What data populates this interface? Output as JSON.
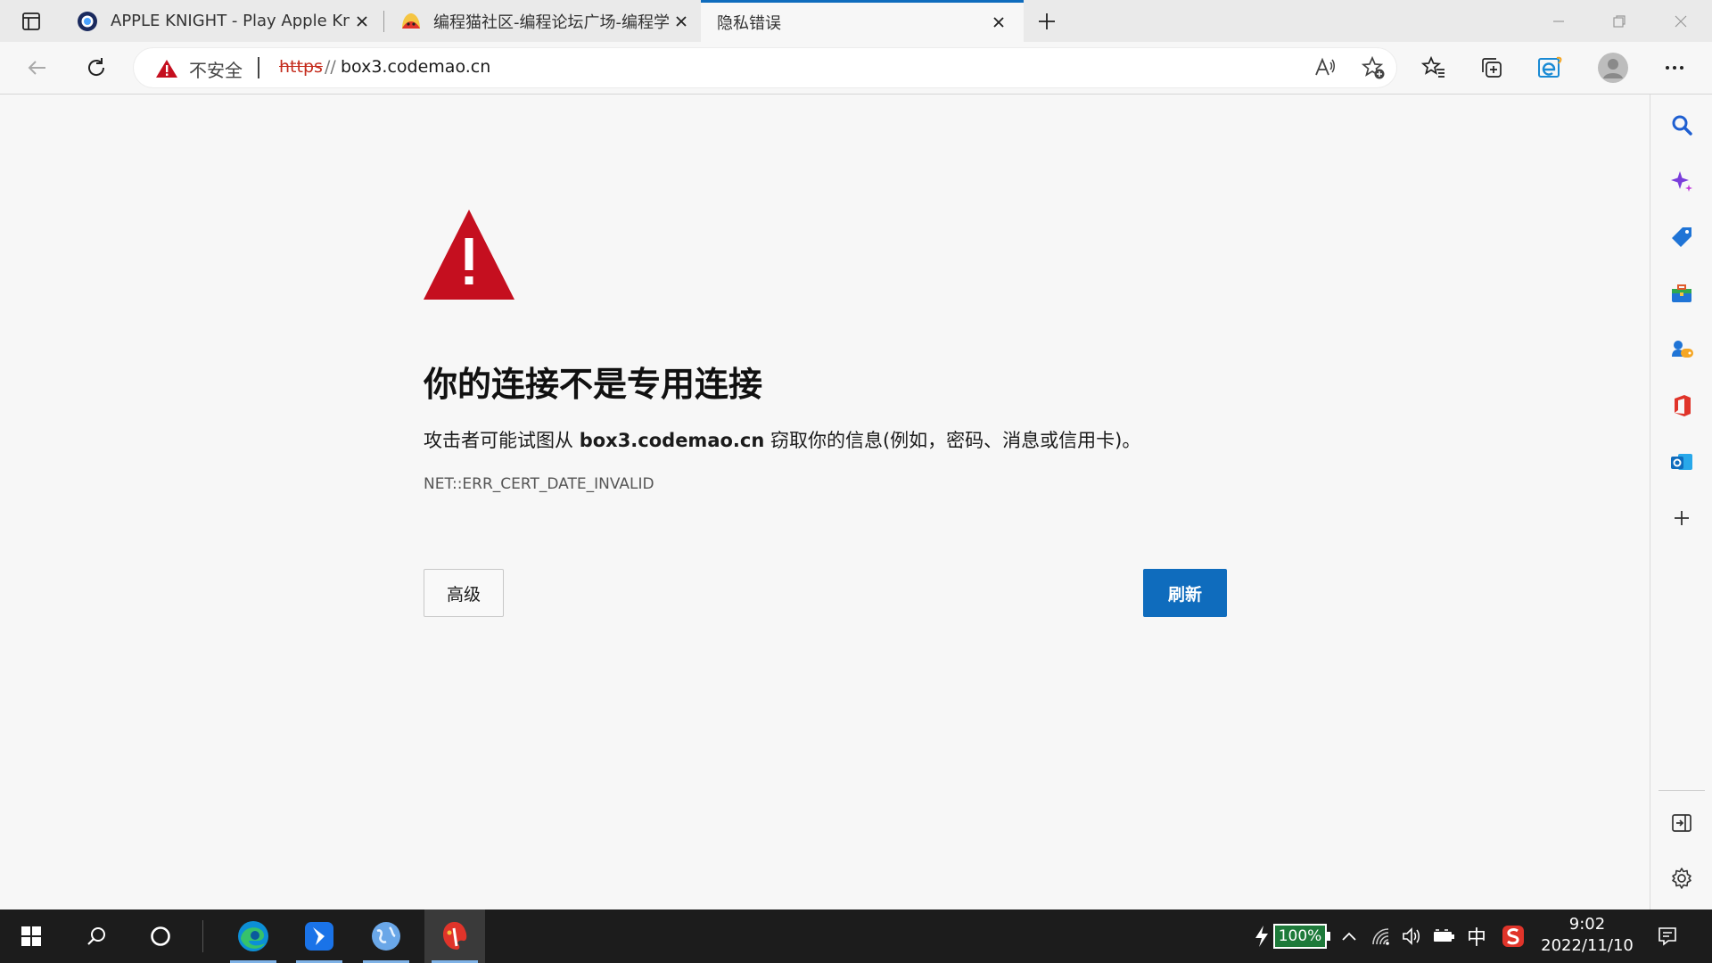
{
  "tabs": [
    {
      "title": "APPLE KNIGHT - Play Apple Knig",
      "active": false,
      "favicon": "globe-ring-icon"
    },
    {
      "title": "编程猫社区-编程论坛广场-编程学",
      "active": false,
      "favicon": "codemao-cat-icon"
    },
    {
      "title": "隐私错误",
      "active": true,
      "favicon": ""
    }
  ],
  "address": {
    "security_label": "不安全",
    "scheme": "https",
    "separator": "//",
    "host": "box3.codemao.cn"
  },
  "error": {
    "title": "你的连接不是专用连接",
    "desc_before": "攻击者可能试图从 ",
    "desc_host": "box3.codemao.cn",
    "desc_after": " 窃取你的信息(例如，密码、消息或信用卡)。",
    "code": "NET::ERR_CERT_DATE_INVALID",
    "advanced_label": "高级",
    "refresh_label": "刷新"
  },
  "colors": {
    "accent": "#0f6cbd",
    "warning_red": "#c50f1f",
    "insecure_scheme": "#c42b1c"
  },
  "taskbar": {
    "battery_percent": "100%",
    "ime_label": "中",
    "time": "9:02",
    "date": "2022/11/10"
  }
}
